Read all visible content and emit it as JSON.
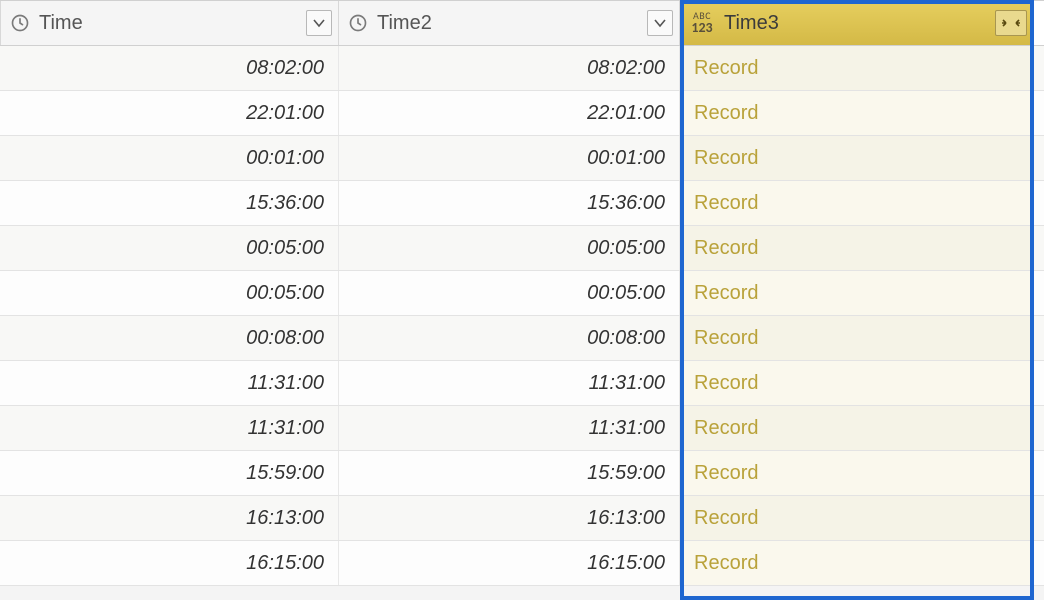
{
  "columns": [
    {
      "key": "time",
      "label": "Time",
      "type": "time",
      "selected": false
    },
    {
      "key": "time2",
      "label": "Time2",
      "type": "time",
      "selected": false
    },
    {
      "key": "time3",
      "label": "Time3",
      "type": "any",
      "selected": true
    }
  ],
  "rows": [
    {
      "time": "08:02:00",
      "time2": "08:02:00",
      "time3": "Record"
    },
    {
      "time": "22:01:00",
      "time2": "22:01:00",
      "time3": "Record"
    },
    {
      "time": "00:01:00",
      "time2": "00:01:00",
      "time3": "Record"
    },
    {
      "time": "15:36:00",
      "time2": "15:36:00",
      "time3": "Record"
    },
    {
      "time": "00:05:00",
      "time2": "00:05:00",
      "time3": "Record"
    },
    {
      "time": "00:05:00",
      "time2": "00:05:00",
      "time3": "Record"
    },
    {
      "time": "00:08:00",
      "time2": "00:08:00",
      "time3": "Record"
    },
    {
      "time": "11:31:00",
      "time2": "11:31:00",
      "time3": "Record"
    },
    {
      "time": "11:31:00",
      "time2": "11:31:00",
      "time3": "Record"
    },
    {
      "time": "15:59:00",
      "time2": "15:59:00",
      "time3": "Record"
    },
    {
      "time": "16:13:00",
      "time2": "16:13:00",
      "time3": "Record"
    },
    {
      "time": "16:15:00",
      "time2": "16:15:00",
      "time3": "Record"
    }
  ],
  "icons": {
    "abc_text": "ABC",
    "n123_text": "123"
  }
}
